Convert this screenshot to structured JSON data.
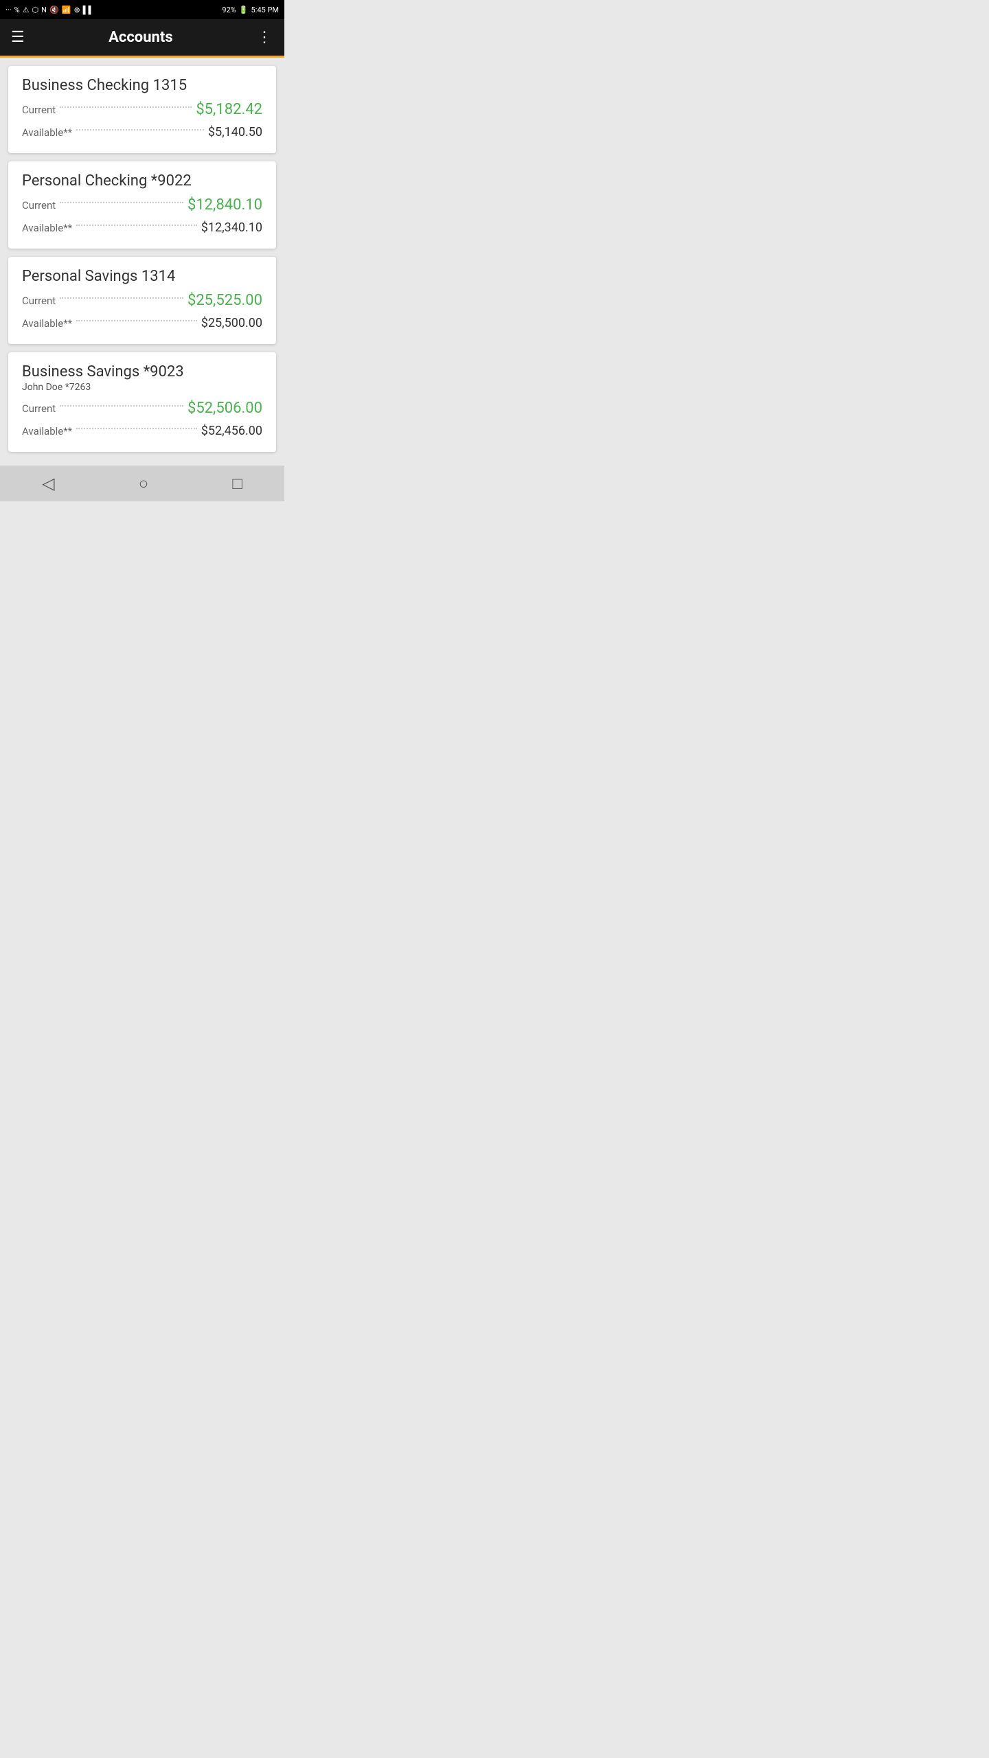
{
  "statusBar": {
    "time": "5:45 PM",
    "battery": "92%",
    "batteryIcon": "🔋",
    "wifiIcon": "📶",
    "bluetoothIcon": "⬡",
    "signalIcon": "📶"
  },
  "toolbar": {
    "menuIcon": "☰",
    "title": "Accounts",
    "moreIcon": "⋮"
  },
  "accounts": [
    {
      "name": "Business Checking 1315",
      "sub": "",
      "currentLabel": "Current",
      "currentAmount": "$5,182.42",
      "availableLabel": "Available**",
      "availableAmount": "$5,140.50"
    },
    {
      "name": "Personal Checking *9022",
      "sub": "",
      "currentLabel": "Current",
      "currentAmount": "$12,840.10",
      "availableLabel": "Available**",
      "availableAmount": "$12,340.10"
    },
    {
      "name": "Personal Savings 1314",
      "sub": "",
      "currentLabel": "Current",
      "currentAmount": "$25,525.00",
      "availableLabel": "Available**",
      "availableAmount": "$25,500.00"
    },
    {
      "name": "Business Savings *9023",
      "sub": "John Doe *7263",
      "currentLabel": "Current",
      "currentAmount": "$52,506.00",
      "availableLabel": "Available**",
      "availableAmount": "$52,456.00"
    }
  ],
  "nav": {
    "backLabel": "◁",
    "homeLabel": "○",
    "recentLabel": "□"
  }
}
